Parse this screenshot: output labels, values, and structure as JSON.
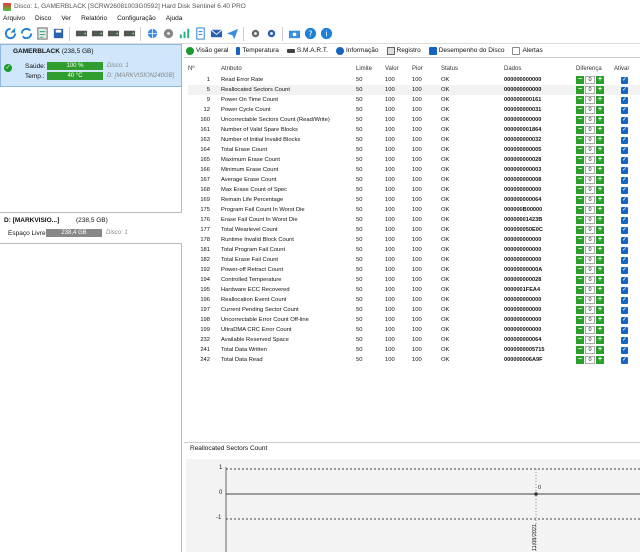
{
  "window": {
    "title": "Disco: 1, GAMERBLACK [SCRW26081003G0592]     Hard Disk Sentinel 6.40 PRO"
  },
  "menu": [
    "Arquivo",
    "Disco",
    "Ver",
    "Relatório",
    "Configuração",
    "Ajuda"
  ],
  "toolbar": [
    "refresh-icon",
    "sync-icon",
    "report-icon",
    "save-icon",
    "drive-icon",
    "drive-icon",
    "drive-icon",
    "drive-icon",
    "globe-icon",
    "disk-icon",
    "chart-icon",
    "document-icon",
    "mail-icon",
    "send-icon",
    "settings-icon",
    "settings-icon",
    "camera-icon",
    "help-icon",
    "info-icon"
  ],
  "disk": {
    "name": "GAMERBLACK",
    "size": "(238,5 GB)",
    "health_label": "Saúde:",
    "health_value": "100 %",
    "health_extra": "Disco: 1",
    "temp_label": "Temp.:",
    "temp_value": "40 °C",
    "temp_extra": "D: [MARKVISION240GB]"
  },
  "partition": {
    "name": "D: [MARKVISIO...]",
    "size": "(238,5 GB)",
    "free_label": "Espaço Livre",
    "free_value": "238,4 GB",
    "free_extra": "Disco: 1"
  },
  "tabs": [
    {
      "label": "Visão geral",
      "icon": "check-icon",
      "color": "#1a9a2b"
    },
    {
      "label": "Temperatura",
      "icon": "thermometer-icon",
      "color": "#1565c0"
    },
    {
      "label": "S.M.A.R.T.",
      "icon": "smart-icon",
      "color": "#444444"
    },
    {
      "label": "Informação",
      "icon": "info-icon",
      "color": "#1565c0"
    },
    {
      "label": "Registro",
      "icon": "log-icon",
      "color": "#666666"
    },
    {
      "label": "Desempenho do Disco",
      "icon": "performance-icon",
      "color": "#1565c0"
    },
    {
      "label": "Alertas",
      "icon": "alert-icon",
      "color": "#888888"
    }
  ],
  "table": {
    "headers": {
      "num": "Nº",
      "attr": "Atributo",
      "lim": "Limite",
      "val": "Valor",
      "pior": "Pior",
      "stat": "Status",
      "data": "Dados",
      "diff": "Diferença",
      "ativ": "Ativar"
    },
    "rows": [
      {
        "num": "1",
        "attr": "Read Error Rate",
        "lim": "50",
        "val": "100",
        "pior": "100",
        "stat": "OK",
        "data": "000000000000",
        "diff": "0"
      },
      {
        "num": "5",
        "attr": "Reallocated Sectors Count",
        "lim": "50",
        "val": "100",
        "pior": "100",
        "stat": "OK",
        "data": "000000000000",
        "diff": "0"
      },
      {
        "num": "9",
        "attr": "Power On Time Count",
        "lim": "50",
        "val": "100",
        "pior": "100",
        "stat": "OK",
        "data": "000000000161",
        "diff": "0"
      },
      {
        "num": "12",
        "attr": "Power Cycle Count",
        "lim": "50",
        "val": "100",
        "pior": "100",
        "stat": "OK",
        "data": "000000000031",
        "diff": "0"
      },
      {
        "num": "160",
        "attr": "Uncorrectable Sectors Count (Read/Write)",
        "lim": "50",
        "val": "100",
        "pior": "100",
        "stat": "OK",
        "data": "000000000000",
        "diff": "0"
      },
      {
        "num": "161",
        "attr": "Number of Valid Spare Blocks",
        "lim": "50",
        "val": "100",
        "pior": "100",
        "stat": "OK",
        "data": "000000001864",
        "diff": "0"
      },
      {
        "num": "163",
        "attr": "Number of Initial Invalid Blocks",
        "lim": "50",
        "val": "100",
        "pior": "100",
        "stat": "OK",
        "data": "000000000032",
        "diff": "0"
      },
      {
        "num": "164",
        "attr": "Total Erase Count",
        "lim": "50",
        "val": "100",
        "pior": "100",
        "stat": "OK",
        "data": "000000000005",
        "diff": "0"
      },
      {
        "num": "165",
        "attr": "Maximum Erase Count",
        "lim": "50",
        "val": "100",
        "pior": "100",
        "stat": "OK",
        "data": "000000000028",
        "diff": "0"
      },
      {
        "num": "166",
        "attr": "Minimum Erase Count",
        "lim": "50",
        "val": "100",
        "pior": "100",
        "stat": "OK",
        "data": "000000000003",
        "diff": "0"
      },
      {
        "num": "167",
        "attr": "Average Erase Count",
        "lim": "50",
        "val": "100",
        "pior": "100",
        "stat": "OK",
        "data": "000000000008",
        "diff": "0"
      },
      {
        "num": "168",
        "attr": "Max Erase Count of Spec",
        "lim": "50",
        "val": "100",
        "pior": "100",
        "stat": "OK",
        "data": "000000000000",
        "diff": "0"
      },
      {
        "num": "169",
        "attr": "Remain Life Percentage",
        "lim": "50",
        "val": "100",
        "pior": "100",
        "stat": "OK",
        "data": "000000000064",
        "diff": "0"
      },
      {
        "num": "175",
        "attr": "Program Fail Count In Worst Die",
        "lim": "50",
        "val": "100",
        "pior": "100",
        "stat": "OK",
        "data": "000000B00000",
        "diff": "0"
      },
      {
        "num": "176",
        "attr": "Erase Fail Count In Worst Die",
        "lim": "50",
        "val": "100",
        "pior": "100",
        "stat": "OK",
        "data": "00000001423B",
        "diff": "0"
      },
      {
        "num": "177",
        "attr": "Total Wearlevel Count",
        "lim": "50",
        "val": "100",
        "pior": "100",
        "stat": "OK",
        "data": "000000050E0C",
        "diff": "0"
      },
      {
        "num": "178",
        "attr": "Runtime Invalid Block Count",
        "lim": "50",
        "val": "100",
        "pior": "100",
        "stat": "OK",
        "data": "000000000000",
        "diff": "0"
      },
      {
        "num": "181",
        "attr": "Total Program Fail Count",
        "lim": "50",
        "val": "100",
        "pior": "100",
        "stat": "OK",
        "data": "000000000000",
        "diff": "0"
      },
      {
        "num": "182",
        "attr": "Total Erase Fail Count",
        "lim": "50",
        "val": "100",
        "pior": "100",
        "stat": "OK",
        "data": "000000000000",
        "diff": "0"
      },
      {
        "num": "192",
        "attr": "Power-off Retract Count",
        "lim": "50",
        "val": "100",
        "pior": "100",
        "stat": "OK",
        "data": "00000000000A",
        "diff": "0"
      },
      {
        "num": "194",
        "attr": "Controlled Temperature",
        "lim": "50",
        "val": "100",
        "pior": "100",
        "stat": "OK",
        "data": "000000000028",
        "diff": "0"
      },
      {
        "num": "195",
        "attr": "Hardware ECC Recovered",
        "lim": "50",
        "val": "100",
        "pior": "100",
        "stat": "OK",
        "data": "0000001FEA4",
        "diff": "0"
      },
      {
        "num": "196",
        "attr": "Reallocation Event Count",
        "lim": "50",
        "val": "100",
        "pior": "100",
        "stat": "OK",
        "data": "000000000000",
        "diff": "0"
      },
      {
        "num": "197",
        "attr": "Current Pending Sector Count",
        "lim": "50",
        "val": "100",
        "pior": "100",
        "stat": "OK",
        "data": "000000000000",
        "diff": "0"
      },
      {
        "num": "198",
        "attr": "Uncorrectable Error Count Off-line",
        "lim": "50",
        "val": "100",
        "pior": "100",
        "stat": "OK",
        "data": "000000000000",
        "diff": "0"
      },
      {
        "num": "199",
        "attr": "UltraDMA CRC Error Count",
        "lim": "50",
        "val": "100",
        "pior": "100",
        "stat": "OK",
        "data": "000000000000",
        "diff": "0"
      },
      {
        "num": "232",
        "attr": "Available Reserved Space",
        "lim": "50",
        "val": "100",
        "pior": "100",
        "stat": "OK",
        "data": "000000000064",
        "diff": "0"
      },
      {
        "num": "241",
        "attr": "Total Data Written",
        "lim": "50",
        "val": "100",
        "pior": "100",
        "stat": "OK",
        "data": "0000000005715",
        "diff": "0"
      },
      {
        "num": "242",
        "attr": "Total Data Read",
        "lim": "50",
        "val": "100",
        "pior": "100",
        "stat": "OK",
        "data": "000000006A9F",
        "diff": "0"
      }
    ]
  },
  "chart": {
    "title": "Reallocated Sectors Count",
    "y_ticks": [
      "1",
      "0",
      "-1"
    ],
    "point_label": "0",
    "x_label": "11/08/2021"
  },
  "chart_data": {
    "type": "line",
    "title": "Reallocated Sectors Count",
    "x": [
      "11/08/2021"
    ],
    "series": [
      {
        "values": [
          0
        ]
      }
    ],
    "ylim": [
      -1,
      1
    ],
    "grid": true
  },
  "colors": {
    "selection": "#cfe6fb",
    "health": "#2f9e2f",
    "accent": "#1565c0",
    "chart_bg": "#f3f3f3"
  }
}
